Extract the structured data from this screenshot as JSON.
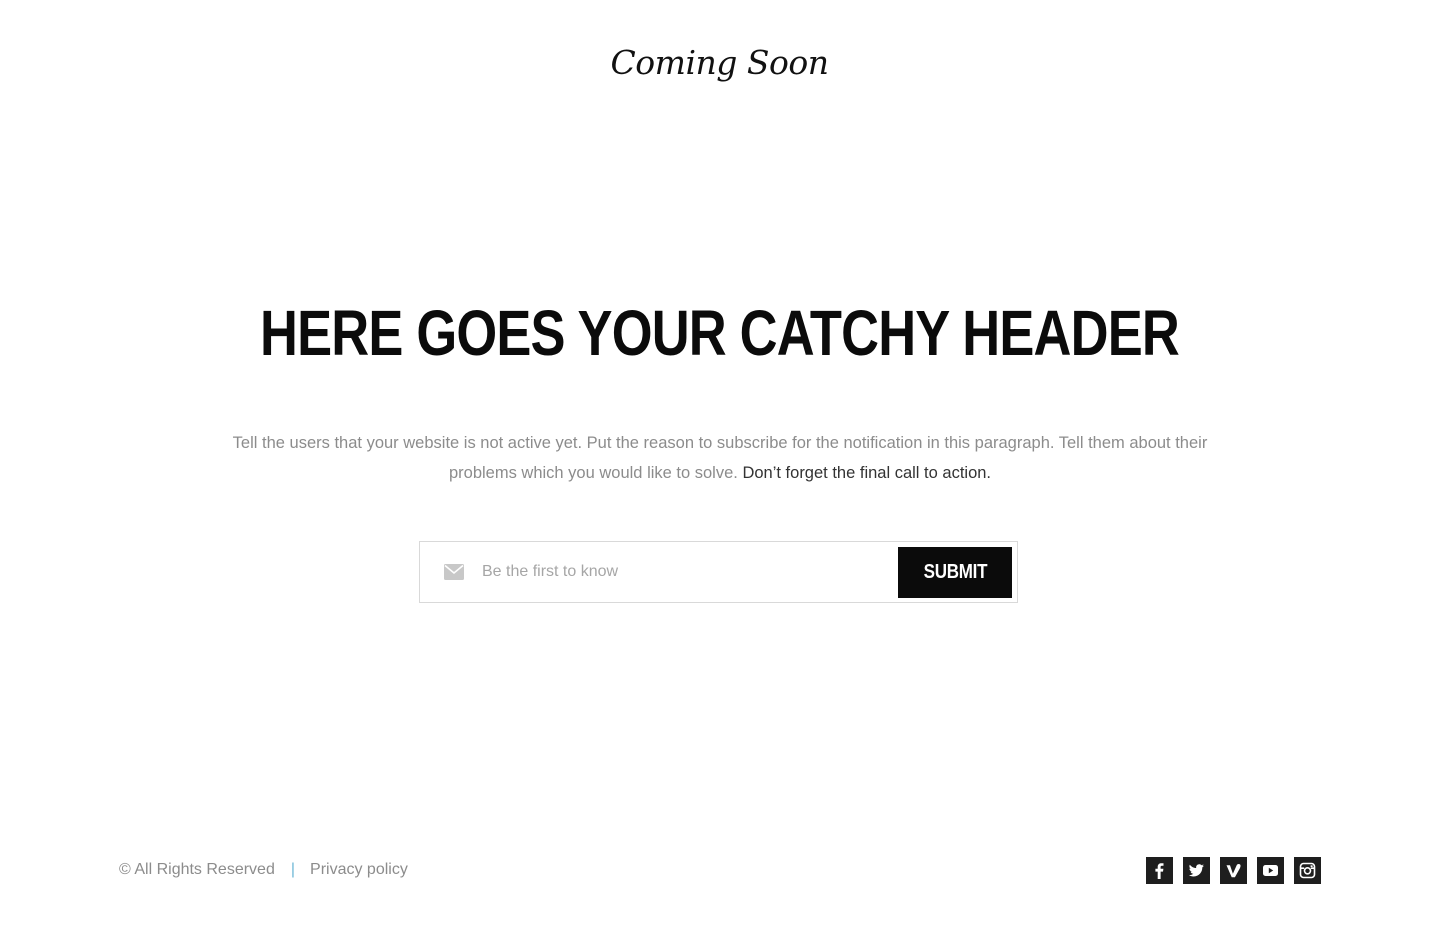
{
  "header": {
    "logo_text": "Coming Soon"
  },
  "hero": {
    "headline": "HERE GOES YOUR CATCHY HEADER",
    "paragraph": "Tell the users that your website is not active yet. Put the reason to subscribe for the notification in this paragraph. Tell them about their problems which you would like to solve. ",
    "call_to_action": "Don’t forget the final call to action."
  },
  "subscribe": {
    "icon": "envelope-icon",
    "placeholder": "Be the first to know",
    "value": "",
    "submit_label": "SUBMIT"
  },
  "footer": {
    "copyright": "© All Rights Reserved",
    "separator": "|",
    "privacy_label": "Privacy policy",
    "social": [
      {
        "icon": "facebook-icon"
      },
      {
        "icon": "twitter-icon"
      },
      {
        "icon": "vimeo-icon"
      },
      {
        "icon": "youtube-icon"
      },
      {
        "icon": "instagram-icon"
      }
    ]
  },
  "colors": {
    "text_dark": "#0b0b0b",
    "text_muted": "#8c8c8c",
    "button_bg": "#0b0b0b",
    "separator_accent": "#6fb8d6",
    "social_bg": "#1e1e1e"
  }
}
